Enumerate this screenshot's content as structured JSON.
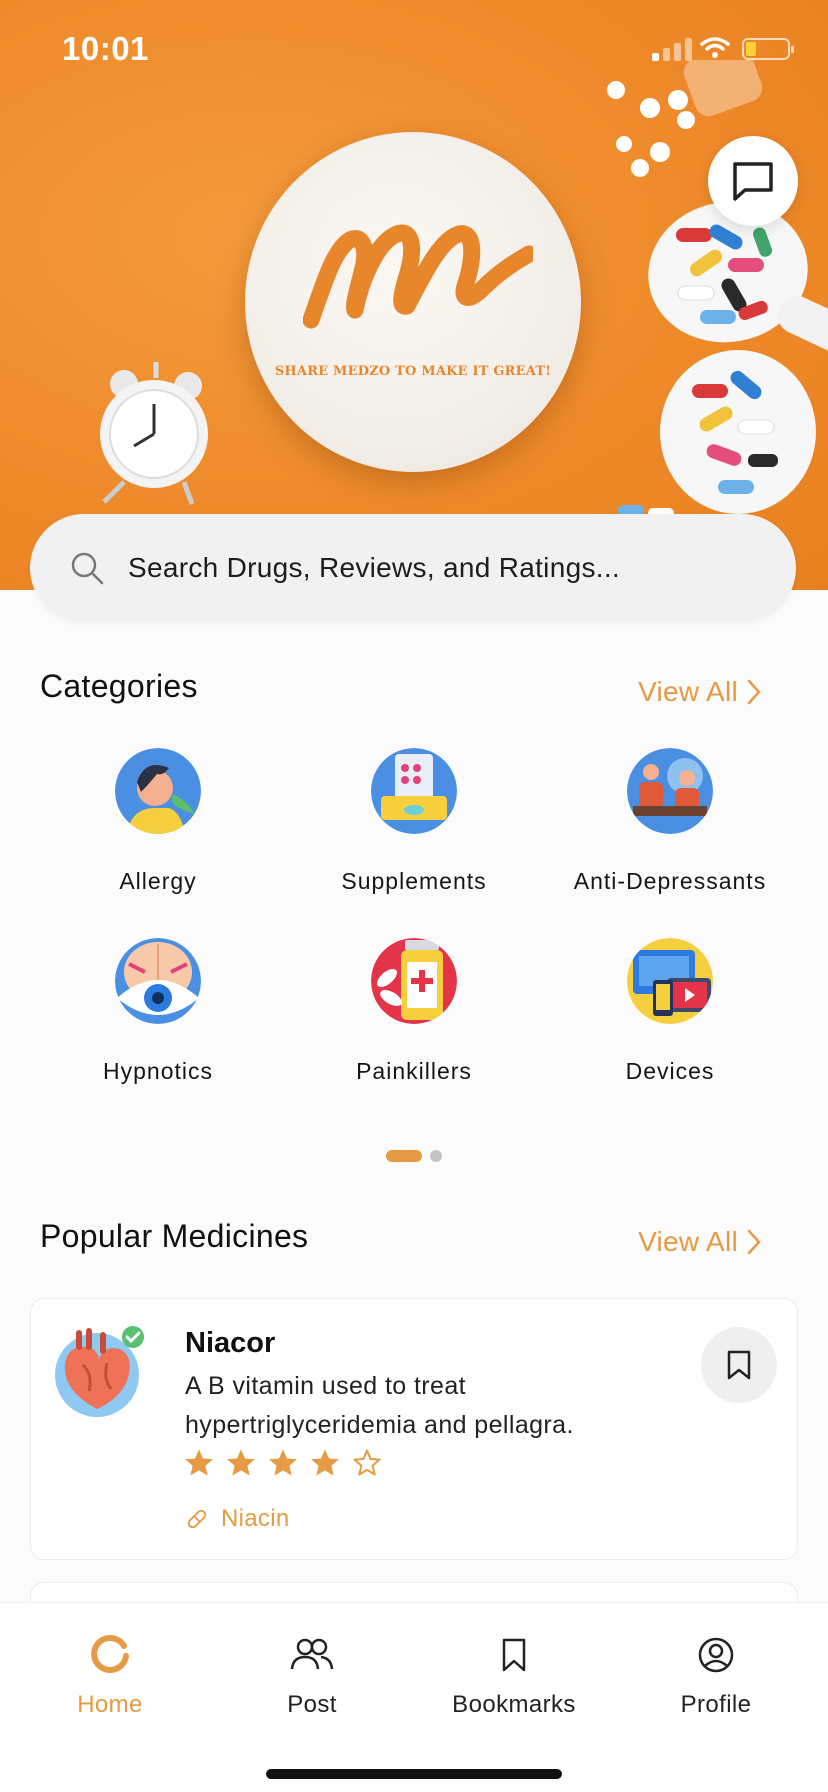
{
  "status_bar": {
    "time": "10:01"
  },
  "hero": {
    "tagline": "SHARE MEDZO TO MAKE IT GREAT!"
  },
  "search": {
    "placeholder": "Search Drugs, Reviews, and Ratings..."
  },
  "categories": {
    "title": "Categories",
    "view_all": "View All",
    "items": [
      {
        "label": "Allergy"
      },
      {
        "label": "Supplements"
      },
      {
        "label": "Anti-Depressants"
      },
      {
        "label": "Hypnotics"
      },
      {
        "label": "Painkillers"
      },
      {
        "label": "Devices"
      }
    ],
    "page_indicator": {
      "current": 1,
      "total": 2
    }
  },
  "popular": {
    "title": "Popular Medicines",
    "view_all": "View All",
    "items": [
      {
        "name": "Niacor",
        "description": "A B vitamin used to treat hypertriglyceridemia and pellagra.",
        "rating": 4,
        "rating_max": 5,
        "ingredient": "Niacin"
      }
    ]
  },
  "tabbar": {
    "tabs": [
      {
        "label": "Home",
        "active": true
      },
      {
        "label": "Post",
        "active": false
      },
      {
        "label": "Bookmarks",
        "active": false
      },
      {
        "label": "Profile",
        "active": false
      }
    ]
  },
  "colors": {
    "accent": "#e59a43",
    "hero": "#ee8a2a"
  }
}
